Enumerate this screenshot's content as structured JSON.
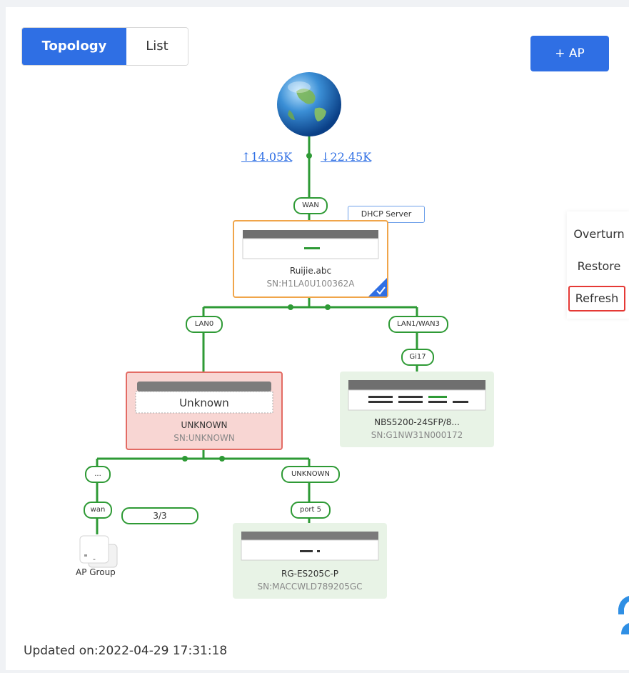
{
  "view_toggle": {
    "topology": "Topology",
    "list": "List"
  },
  "add_ap_label": "+ AP",
  "internet": {
    "upload": "↑14.05K",
    "download": "↓22.45K"
  },
  "dhcp_badge": "DHCP Server",
  "router": {
    "port": "WAN",
    "name": "Ruijie.abc",
    "sn": "SN:H1LA0U100362A"
  },
  "ports": {
    "lan0": "LAN0",
    "lan1_wan3": "LAN1/WAN3",
    "gi17": "Gi17",
    "dots": "...",
    "wan": "wan",
    "unknown": "UNKNOWN",
    "port5": "port 5"
  },
  "unknown_device": {
    "screen": "Unknown",
    "name": "UNKNOWN",
    "sn": "SN:UNKNOWN"
  },
  "switch_device": {
    "name": "NBS5200-24SFP/8...",
    "sn": "SN:G1NW31N000172"
  },
  "small_switch": {
    "name": "RG-ES205C-P",
    "sn": "SN:MACCWLD789205GC"
  },
  "ap_group": {
    "count": "3/3",
    "label": "AP Group",
    "ap_dash": "-"
  },
  "side_menu": {
    "overturn": "Overturn",
    "restore": "Restore",
    "refresh": "Refresh"
  },
  "updated_on": "Updated on:2022-04-29 17:31:18",
  "colors": {
    "accent": "#2f6fe4",
    "link_line": "#2e9a35",
    "router_border": "#f0a54a",
    "unknown_bg": "#f8d6d3",
    "switch_bg": "#e8f3e6"
  }
}
